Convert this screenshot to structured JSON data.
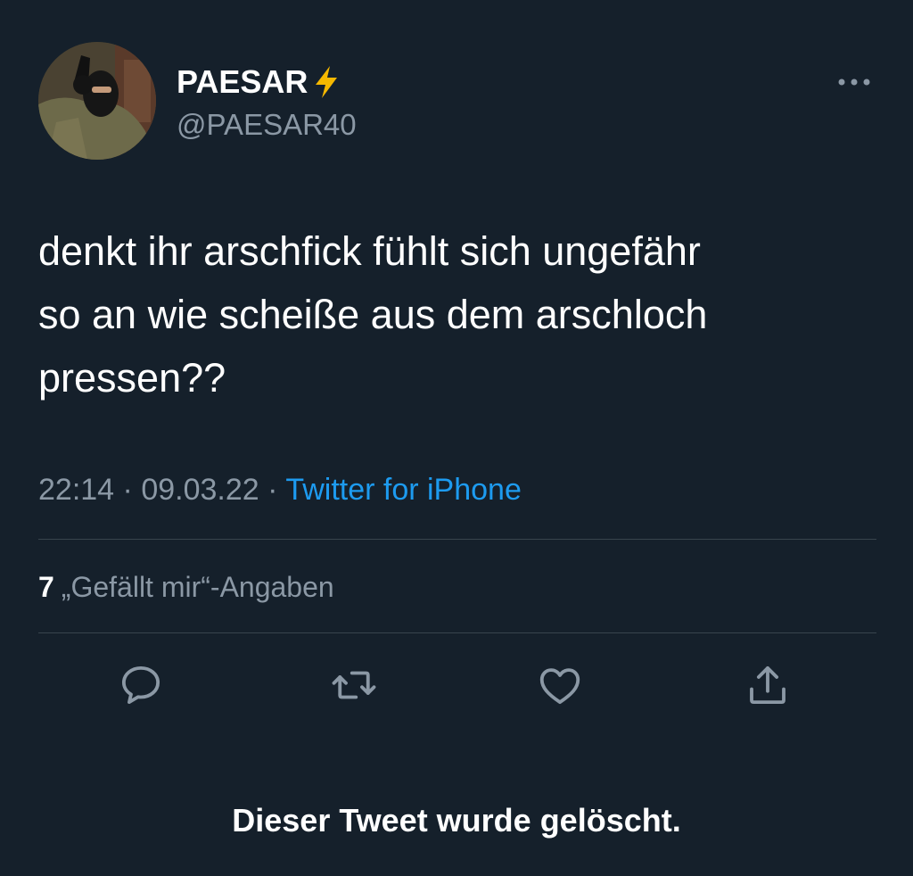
{
  "tweet": {
    "author": {
      "display_name": "PAESAR",
      "badge_icon": "lightning-bolt-icon",
      "handle": "@PAESAR40"
    },
    "text": "denkt ihr arschfick fühlt sich ungefähr\nso an wie scheiße aus dem arschloch\npressen??",
    "time": "22:14",
    "date": "09.03.22",
    "separator": "·",
    "source": "Twitter for iPhone",
    "likes": {
      "count": "7",
      "label": "„Gefällt mir“-Angaben"
    },
    "actions": [
      "reply-icon",
      "retweet-icon",
      "like-icon",
      "share-icon"
    ]
  },
  "footer": {
    "deleted_notice": "Dieser Tweet wurde gelöscht."
  },
  "colors": {
    "background": "#15202b",
    "text_primary": "#ffffff",
    "text_secondary": "#8b98a5",
    "link": "#1d9bf0",
    "divider": "#38444d",
    "badge": "#f5b800"
  }
}
